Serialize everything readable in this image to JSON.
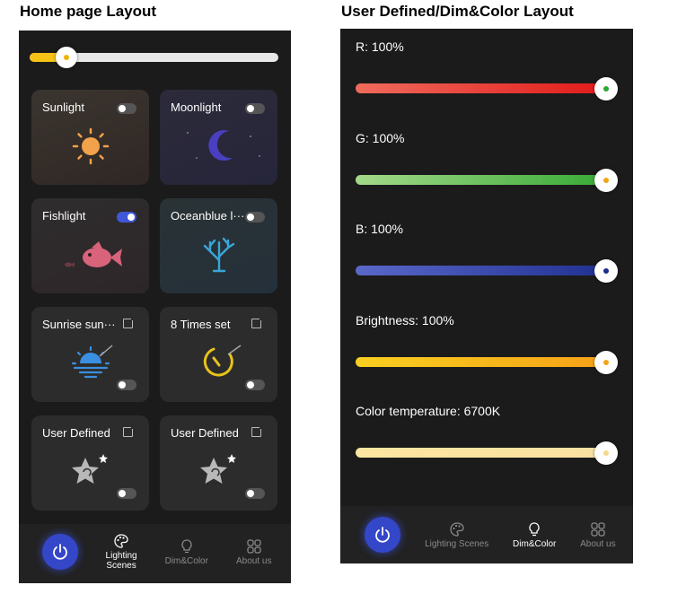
{
  "headings": {
    "left": "Home page Layout",
    "right": "User Defined/Dim&Color Layout"
  },
  "home": {
    "brightness_level": 0.12,
    "cards": [
      {
        "title": "Sunlight",
        "icon": "sun-icon",
        "switch": "off"
      },
      {
        "title": "Moonlight",
        "icon": "moon-icon",
        "switch": "off"
      },
      {
        "title": "Fishlight",
        "icon": "fish-icon",
        "switch": "on"
      },
      {
        "title": "Oceanblue l···",
        "icon": "coral-icon",
        "switch": "off"
      },
      {
        "title": "Sunrise sun···",
        "icon": "sunrise-icon",
        "switch": "off"
      },
      {
        "title": "8 Times set",
        "icon": "timer-icon",
        "switch": "off"
      },
      {
        "title": "User Defined",
        "icon": "star-icon",
        "switch": "off"
      },
      {
        "title": "User Defined",
        "icon": "star-icon",
        "switch": "off"
      }
    ],
    "nav": {
      "lighting_line1": "Lighting",
      "lighting_line2": "Scenes",
      "dim": "Dim&Color",
      "about": "About us",
      "active": "lighting"
    }
  },
  "dim": {
    "sliders": [
      {
        "label": "R: 100%",
        "level": 1.0,
        "gradient": [
          "#f06b5c",
          "#e01818"
        ],
        "dot": "#d8181c"
      },
      {
        "label": "G: 100%",
        "level": 1.0,
        "gradient": [
          "#a4d98a",
          "#34a833"
        ],
        "dot": "#2ea834"
      },
      {
        "label": "B: 100%",
        "level": 1.0,
        "gradient": [
          "#5a68c9",
          "#1f2f8f"
        ],
        "dot": "#1c2d8a"
      },
      {
        "label": "Brightness: 100%",
        "level": 1.0,
        "gradient": [
          "#f8cf20",
          "#f5a017"
        ],
        "dot": "#f2a416"
      },
      {
        "label": "Color temperature: 6700K",
        "level": 1.0,
        "gradient": [
          "#fde6a0",
          "#f8e0a2"
        ],
        "dot": "#f5d98a"
      }
    ],
    "nav": {
      "lighting": "Lighting Scenes",
      "dim": "Dim&Color",
      "about": "About us",
      "active": "dim"
    }
  },
  "colors": {
    "accent_blue": "#3447c8",
    "accent_yellow": "#f5c316",
    "phone_bg": "#1b1b1b"
  }
}
